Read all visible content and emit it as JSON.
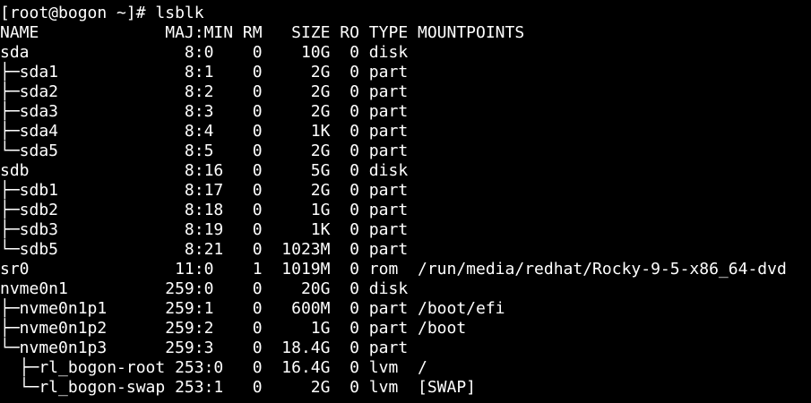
{
  "terminal": {
    "background": "#000000",
    "foreground": "#ffffff",
    "lines": [
      "[root@bogon ~]# lsblk",
      "NAME             MAJ:MIN RM   SIZE RO TYPE MOUNTPOINTS",
      "sda                8:0    0    10G  0 disk",
      "├─sda1             8:1    0     2G  0 part",
      "├─sda2             8:2    0     2G  0 part",
      "├─sda3             8:3    0     2G  0 part",
      "├─sda4             8:4    0     1K  0 part",
      "└─sda5             8:5    0     2G  0 part",
      "sdb                8:16   0     5G  0 disk",
      "├─sdb1             8:17   0     2G  0 part",
      "├─sdb2             8:18   0     1G  0 part",
      "├─sdb3             8:19   0     1K  0 part",
      "└─sdb5             8:21   0  1023M  0 part",
      "sr0               11:0    1  1019M  0 rom  /run/media/redhat/Rocky-9-5-x86_64-dvd",
      "nvme0n1          259:0    0    20G  0 disk",
      "├─nvme0n1p1      259:1    0   600M  0 part /boot/efi",
      "├─nvme0n1p2      259:2    0     1G  0 part /boot",
      "└─nvme0n1p3      259:3    0  18.4G  0 part",
      "  ├─rl_bogon-root 253:0   0  16.4G  0 lvm  /",
      "  └─rl_bogon-swap 253:1   0     2G  0 lvm  [SWAP]"
    ]
  }
}
